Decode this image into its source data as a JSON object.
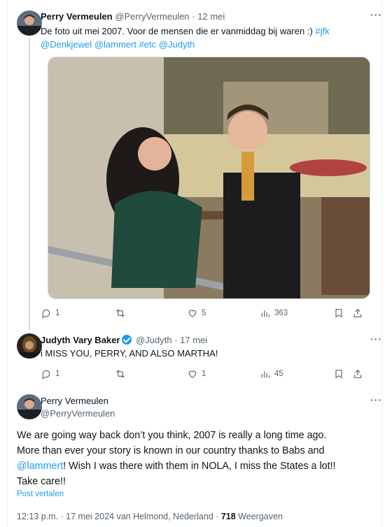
{
  "tweet1": {
    "display_name": "Perry Vermeulen",
    "handle": "@PerryVermeulen",
    "date": "12 mei",
    "text_plain": "De foto uit mei 2007. Voor de mensen die er vanmiddag bij waren :) ",
    "tag_jfk": "#jfk",
    "mention1": "@Denkjewel",
    "mention2": "@lammert",
    "tag_etc": "#etc",
    "mention3": "@Judyth",
    "replies": "1",
    "likes": "5",
    "views": "363"
  },
  "tweet2": {
    "display_name": "Judyth Vary Baker",
    "handle": "@Judyth",
    "date": "17 mei",
    "text": "i MISS YOU, PERRY, AND ALSO MARTHA!",
    "replies": "1",
    "likes": "1",
    "views": "45"
  },
  "tweet3": {
    "display_name": "Perry Vermeulen",
    "handle": "@PerryVermeulen",
    "text_a": "We are going way back don’t you think, 2007 is really a long time ago.",
    "text_b": "More than ever your story is known in our country thanks to Babs and",
    "mention": "@lammert",
    "text_c": "! Wish I was there with them in NOLA, I miss the States a lot!!",
    "text_d": "Take care!!",
    "translate": "Post vertalen",
    "meta_time": "12:13 p.m. · 17 mei 2024 van Helmond, Nederland · ",
    "views_count": "718",
    "views_label": "Weergaven"
  },
  "sep": "·",
  "icons": [
    "more-icon",
    "reply-icon",
    "repost-icon",
    "like-icon",
    "views-icon",
    "bookmark-icon",
    "share-icon",
    "verified-icon"
  ],
  "colors": {
    "link": "#1d9bf0",
    "muted": "#536471",
    "text": "#0f1419"
  }
}
